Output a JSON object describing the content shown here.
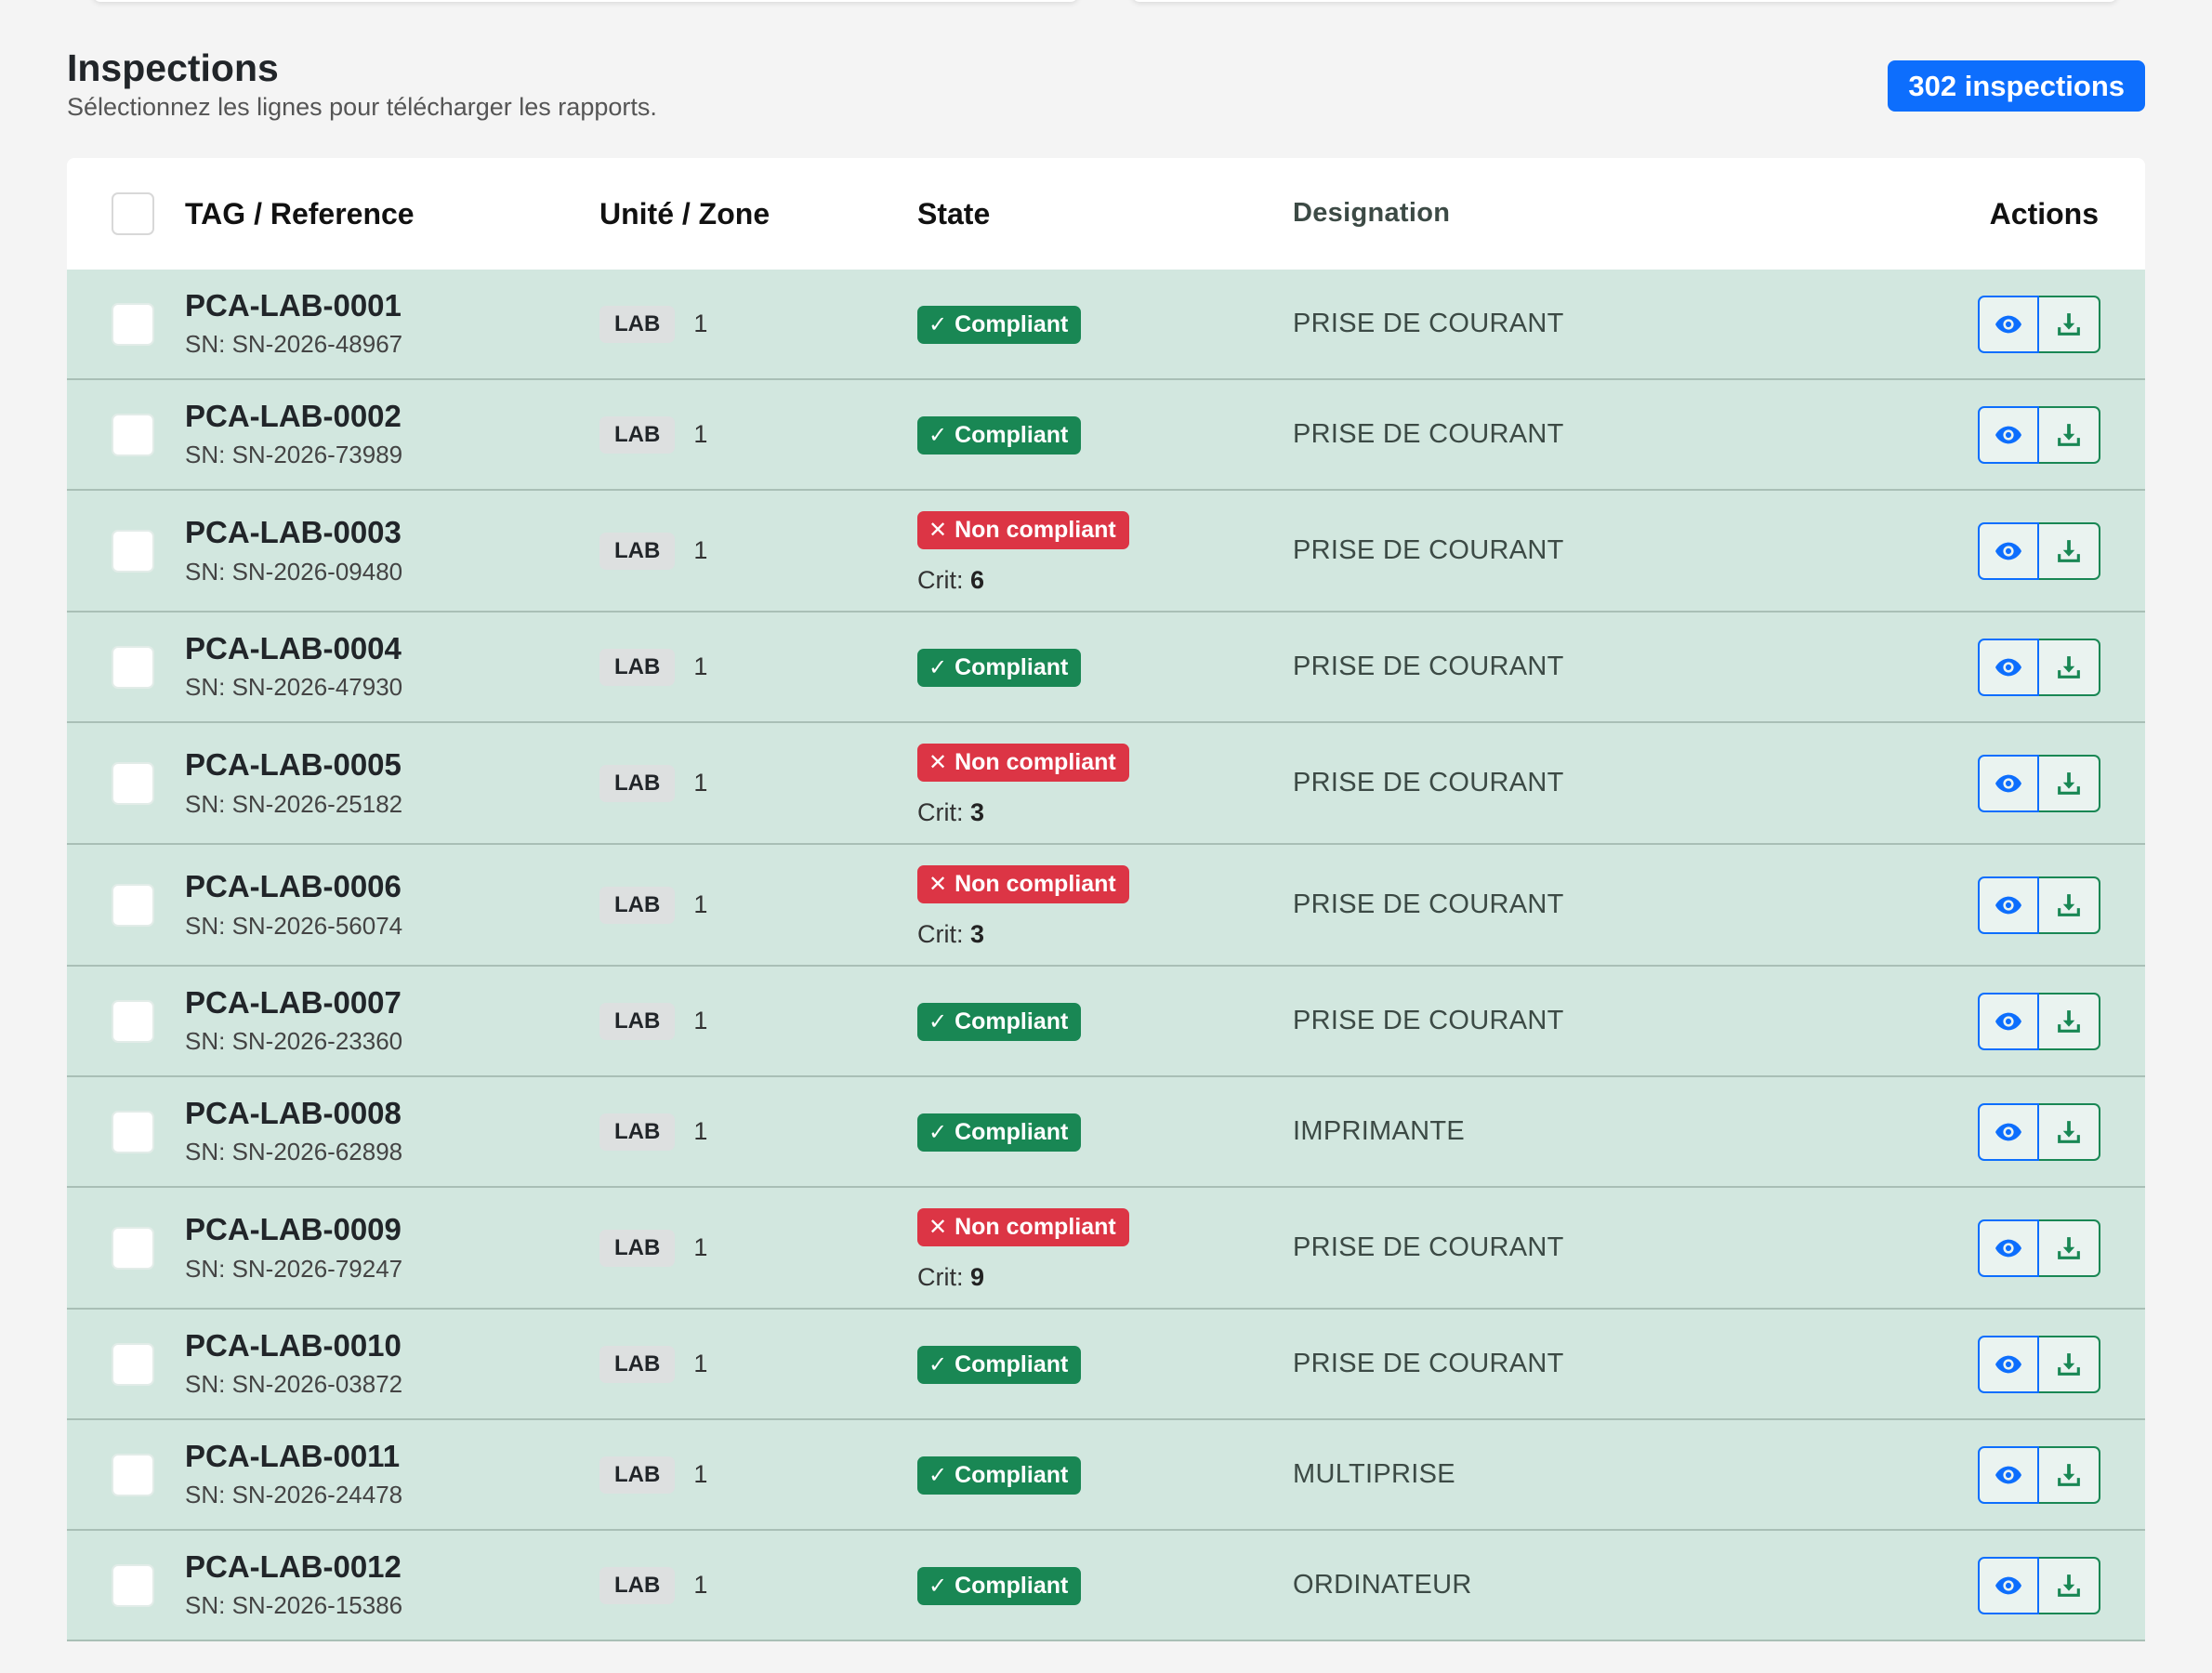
{
  "header": {
    "title": "Inspections",
    "subtitle": "Sélectionnez les lignes pour télécharger les rapports.",
    "count_badge": "302 inspections"
  },
  "table": {
    "columns": {
      "tag": "TAG / Reference",
      "unit": "Unité / Zone",
      "state": "State",
      "designation": "Designation",
      "actions": "Actions"
    },
    "rows": [
      {
        "tag": "PCA-LAB-0001",
        "sn": "SN: SN-2026-48967",
        "zone": "LAB",
        "zone_num": "1",
        "state": "Compliant",
        "crit": null,
        "designation": "PRISE DE COURANT"
      },
      {
        "tag": "PCA-LAB-0002",
        "sn": "SN: SN-2026-73989",
        "zone": "LAB",
        "zone_num": "1",
        "state": "Compliant",
        "crit": null,
        "designation": "PRISE DE COURANT"
      },
      {
        "tag": "PCA-LAB-0003",
        "sn": "SN: SN-2026-09480",
        "zone": "LAB",
        "zone_num": "1",
        "state": "Non compliant",
        "crit": "6",
        "designation": "PRISE DE COURANT"
      },
      {
        "tag": "PCA-LAB-0004",
        "sn": "SN: SN-2026-47930",
        "zone": "LAB",
        "zone_num": "1",
        "state": "Compliant",
        "crit": null,
        "designation": "PRISE DE COURANT"
      },
      {
        "tag": "PCA-LAB-0005",
        "sn": "SN: SN-2026-25182",
        "zone": "LAB",
        "zone_num": "1",
        "state": "Non compliant",
        "crit": "3",
        "designation": "PRISE DE COURANT"
      },
      {
        "tag": "PCA-LAB-0006",
        "sn": "SN: SN-2026-56074",
        "zone": "LAB",
        "zone_num": "1",
        "state": "Non compliant",
        "crit": "3",
        "designation": "PRISE DE COURANT"
      },
      {
        "tag": "PCA-LAB-0007",
        "sn": "SN: SN-2026-23360",
        "zone": "LAB",
        "zone_num": "1",
        "state": "Compliant",
        "crit": null,
        "designation": "PRISE DE COURANT"
      },
      {
        "tag": "PCA-LAB-0008",
        "sn": "SN: SN-2026-62898",
        "zone": "LAB",
        "zone_num": "1",
        "state": "Compliant",
        "crit": null,
        "designation": "IMPRIMANTE"
      },
      {
        "tag": "PCA-LAB-0009",
        "sn": "SN: SN-2026-79247",
        "zone": "LAB",
        "zone_num": "1",
        "state": "Non compliant",
        "crit": "9",
        "designation": "PRISE DE COURANT"
      },
      {
        "tag": "PCA-LAB-0010",
        "sn": "SN: SN-2026-03872",
        "zone": "LAB",
        "zone_num": "1",
        "state": "Compliant",
        "crit": null,
        "designation": "PRISE DE COURANT"
      },
      {
        "tag": "PCA-LAB-0011",
        "sn": "SN: SN-2026-24478",
        "zone": "LAB",
        "zone_num": "1",
        "state": "Compliant",
        "crit": null,
        "designation": "MULTIPRISE"
      },
      {
        "tag": "PCA-LAB-0012",
        "sn": "SN: SN-2026-15386",
        "zone": "LAB",
        "zone_num": "1",
        "state": "Compliant",
        "crit": null,
        "designation": "ORDINATEUR"
      }
    ],
    "crit_label": "Crit:",
    "icons": {
      "compliant": "check-icon",
      "non_compliant": "x-icon",
      "view": "eye-icon",
      "download": "download-icon"
    }
  },
  "colors": {
    "accent": "#0d6efd",
    "success": "#198754",
    "danger": "#dc3545",
    "row_bg": "#d2e7df"
  }
}
